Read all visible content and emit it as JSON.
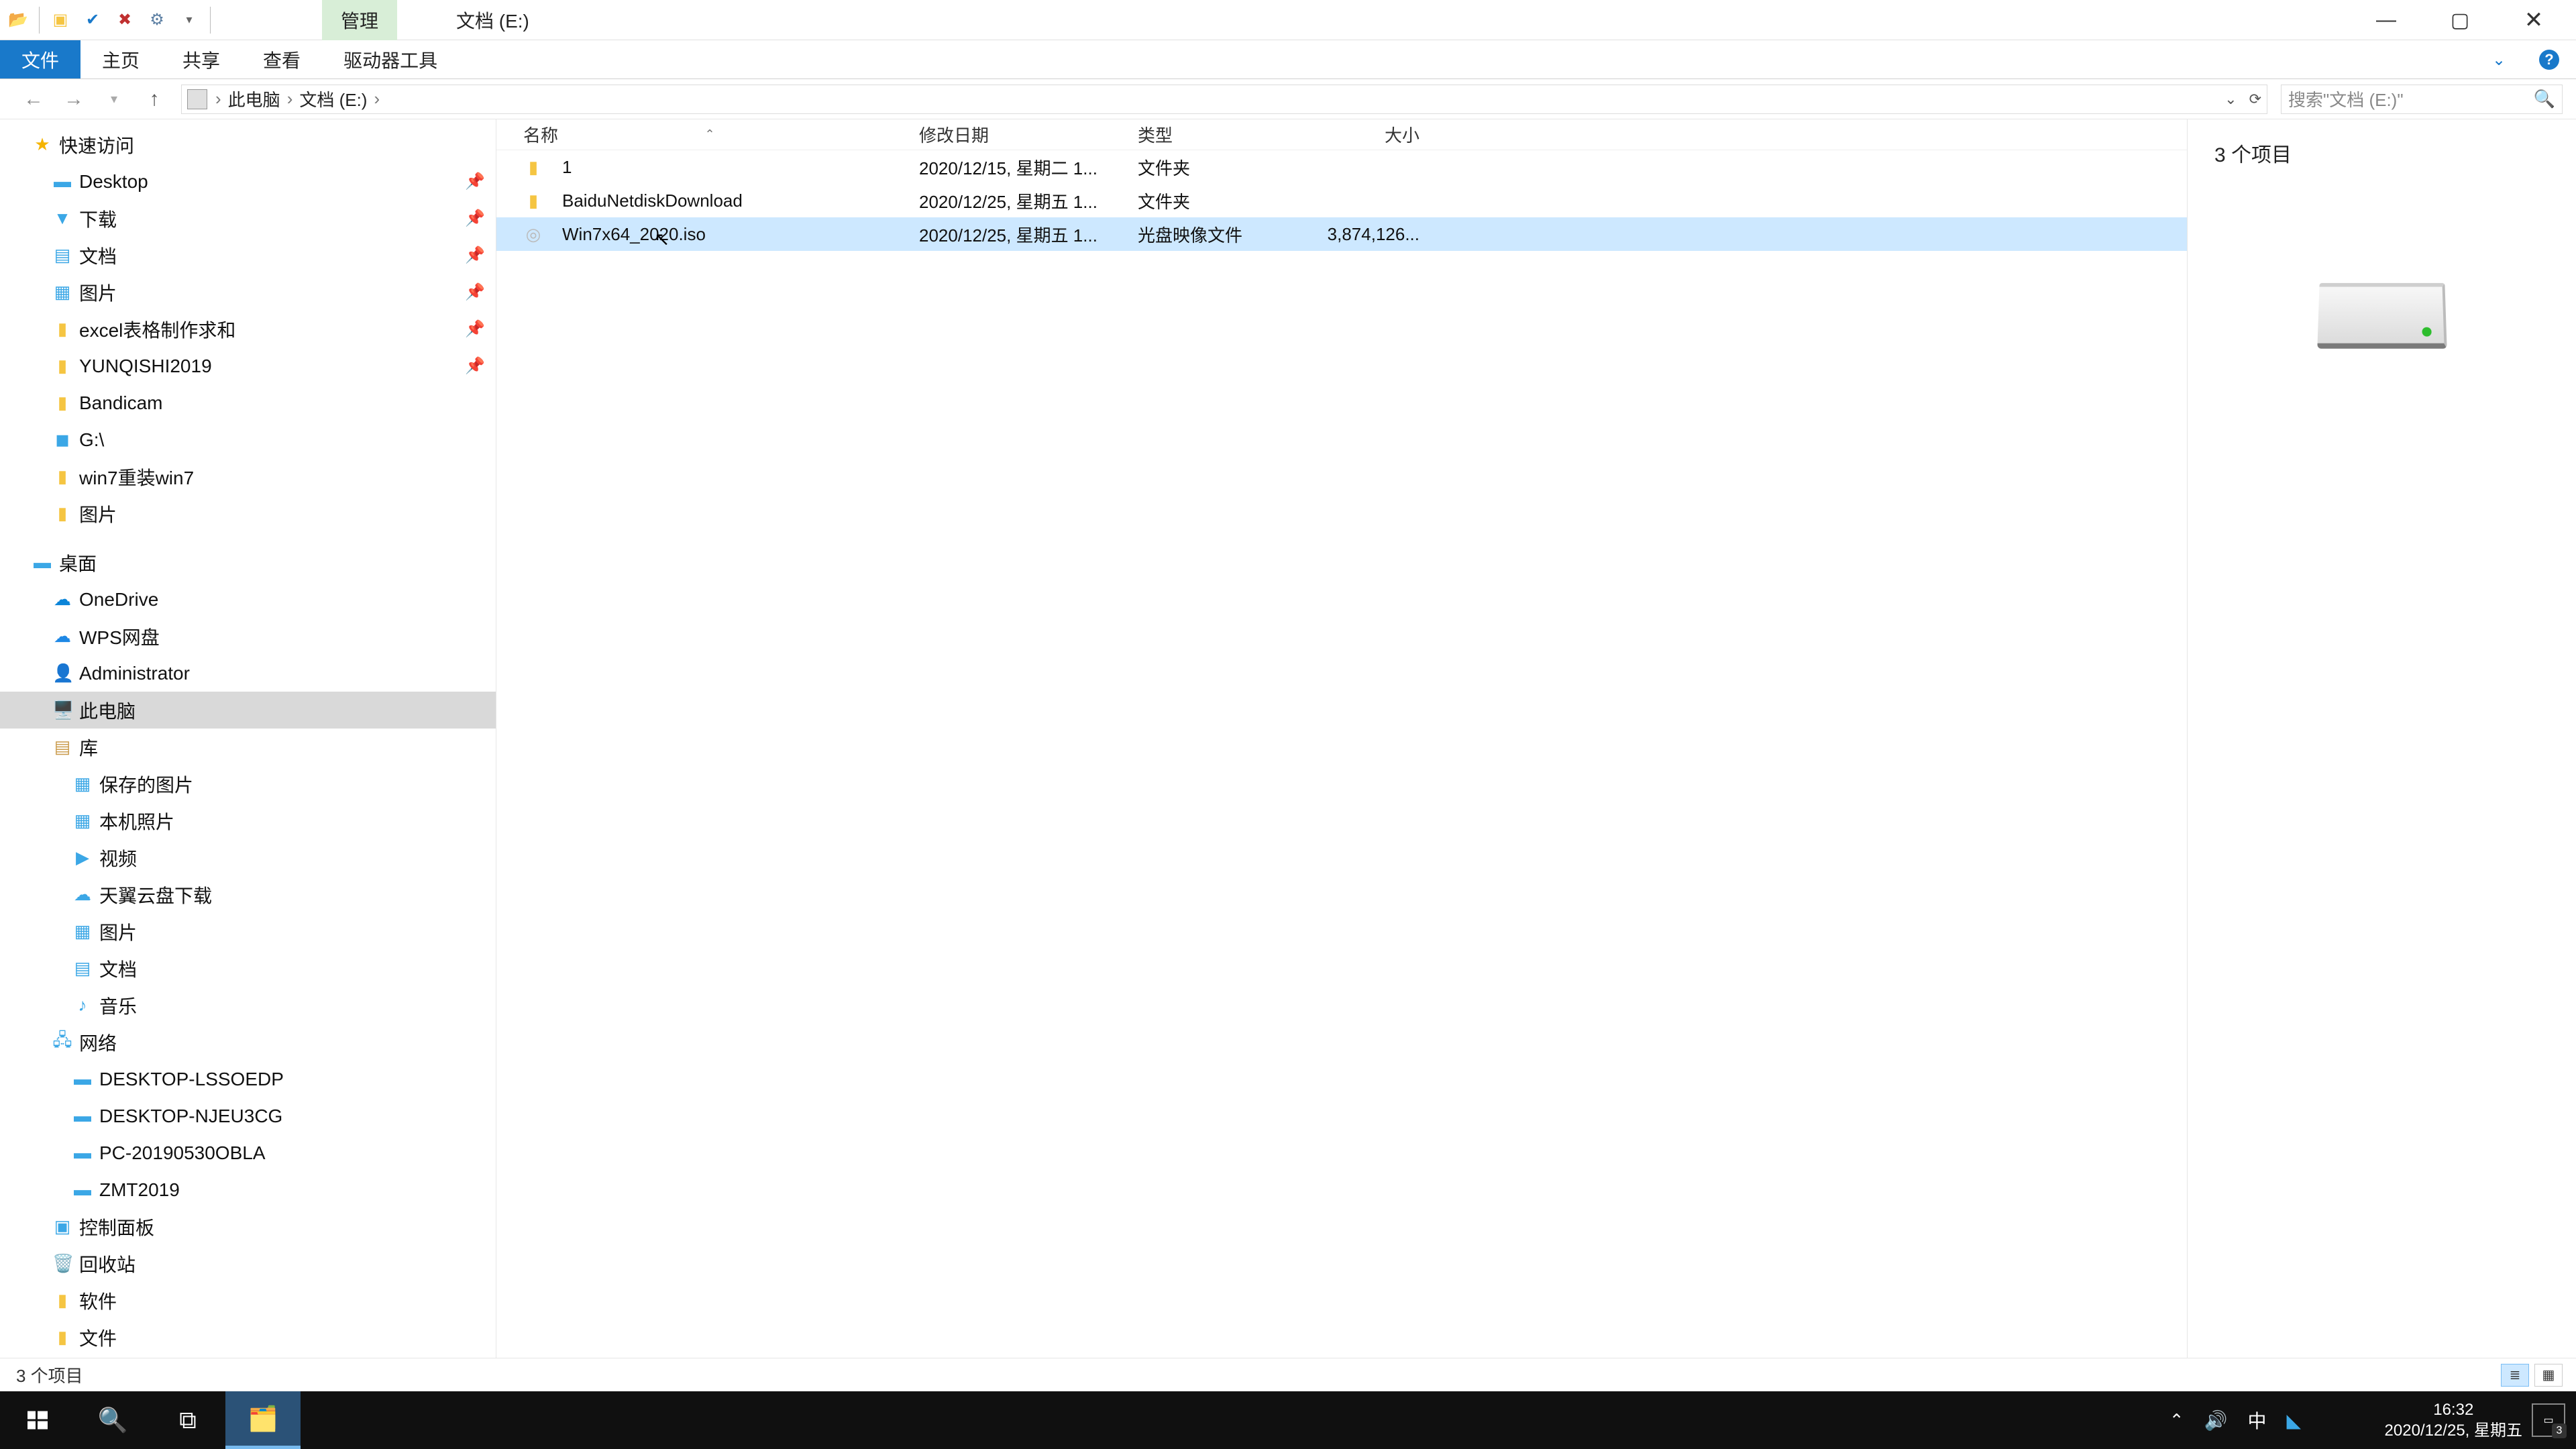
{
  "titlebar": {
    "ribbon_context_tab": "管理",
    "drive_title": "文档 (E:)"
  },
  "ribbon": {
    "file": "文件",
    "home": "主页",
    "share": "共享",
    "view": "查看",
    "drive_tools": "驱动器工具"
  },
  "addressbar": {
    "parts": [
      "此电脑",
      "文档 (E:)"
    ]
  },
  "search": {
    "placeholder": "搜索\"文档 (E:)\""
  },
  "tree": {
    "quick_access": "快速访问",
    "quick": [
      {
        "label": "Desktop",
        "icon": "🖥️",
        "pinned": true
      },
      {
        "label": "下载",
        "icon": "📥",
        "pinned": true
      },
      {
        "label": "文档",
        "icon": "📄",
        "pinned": true
      },
      {
        "label": "图片",
        "icon": "🖼️",
        "pinned": true
      },
      {
        "label": "excel表格制作求和",
        "icon": "📁",
        "pinned": true
      },
      {
        "label": "YUNQISHI2019",
        "icon": "📁",
        "pinned": true
      },
      {
        "label": "Bandicam",
        "icon": "📁",
        "pinned": false
      },
      {
        "label": "G:\\",
        "icon": "💽",
        "pinned": false
      },
      {
        "label": "win7重装win7",
        "icon": "📁",
        "pinned": false
      },
      {
        "label": "图片",
        "icon": "📁",
        "pinned": false
      }
    ],
    "desktop_hdr": "桌面",
    "desktop": [
      {
        "label": "OneDrive",
        "icon": "color:#0a84d8",
        "glyph": "☁"
      },
      {
        "label": "WPS网盘",
        "icon": "color:#1e88e5",
        "glyph": "☁"
      },
      {
        "label": "Administrator",
        "icon": "",
        "glyph": "👤"
      },
      {
        "label": "此电脑",
        "icon": "",
        "glyph": "🖥️",
        "selected": true
      },
      {
        "label": "库",
        "icon": "",
        "glyph": "📚"
      }
    ],
    "libs": [
      {
        "label": "保存的图片",
        "glyph": "🖼️"
      },
      {
        "label": "本机照片",
        "glyph": "🖼️"
      },
      {
        "label": "视频",
        "glyph": "🎞️"
      },
      {
        "label": "天翼云盘下载",
        "glyph": "☁"
      },
      {
        "label": "图片",
        "glyph": "🖼️"
      },
      {
        "label": "文档",
        "glyph": "📄"
      },
      {
        "label": "音乐",
        "glyph": "🎵"
      }
    ],
    "network_hdr": "网络",
    "network": [
      {
        "label": "DESKTOP-LSSOEDP",
        "glyph": "🖥️"
      },
      {
        "label": "DESKTOP-NJEU3CG",
        "glyph": "🖥️"
      },
      {
        "label": "PC-20190530OBLA",
        "glyph": "🖥️"
      },
      {
        "label": "ZMT2019",
        "glyph": "🖥️"
      }
    ],
    "misc": [
      {
        "label": "控制面板",
        "glyph": "🛠️"
      },
      {
        "label": "回收站",
        "glyph": "🗑️"
      },
      {
        "label": "软件",
        "glyph": "📁"
      },
      {
        "label": "文件",
        "glyph": "📁"
      }
    ]
  },
  "columns": {
    "name": "名称",
    "date": "修改日期",
    "type": "类型",
    "size": "大小"
  },
  "files": [
    {
      "name": "1",
      "date": "2020/12/15, 星期二 1...",
      "type": "文件夹",
      "size": "",
      "icon": "📁"
    },
    {
      "name": "BaiduNetdiskDownload",
      "date": "2020/12/25, 星期五 1...",
      "type": "文件夹",
      "size": "",
      "icon": "📁"
    },
    {
      "name": "Win7x64_2020.iso",
      "date": "2020/12/25, 星期五 1...",
      "type": "光盘映像文件",
      "size": "3,874,126...",
      "icon": "💿",
      "selected": true
    }
  ],
  "preview": {
    "count_text": "3 个项目"
  },
  "statusbar": {
    "text": "3 个项目"
  },
  "taskbar": {
    "time": "16:32",
    "date": "2020/12/25, 星期五",
    "ime": "中",
    "notif_count": "3"
  }
}
